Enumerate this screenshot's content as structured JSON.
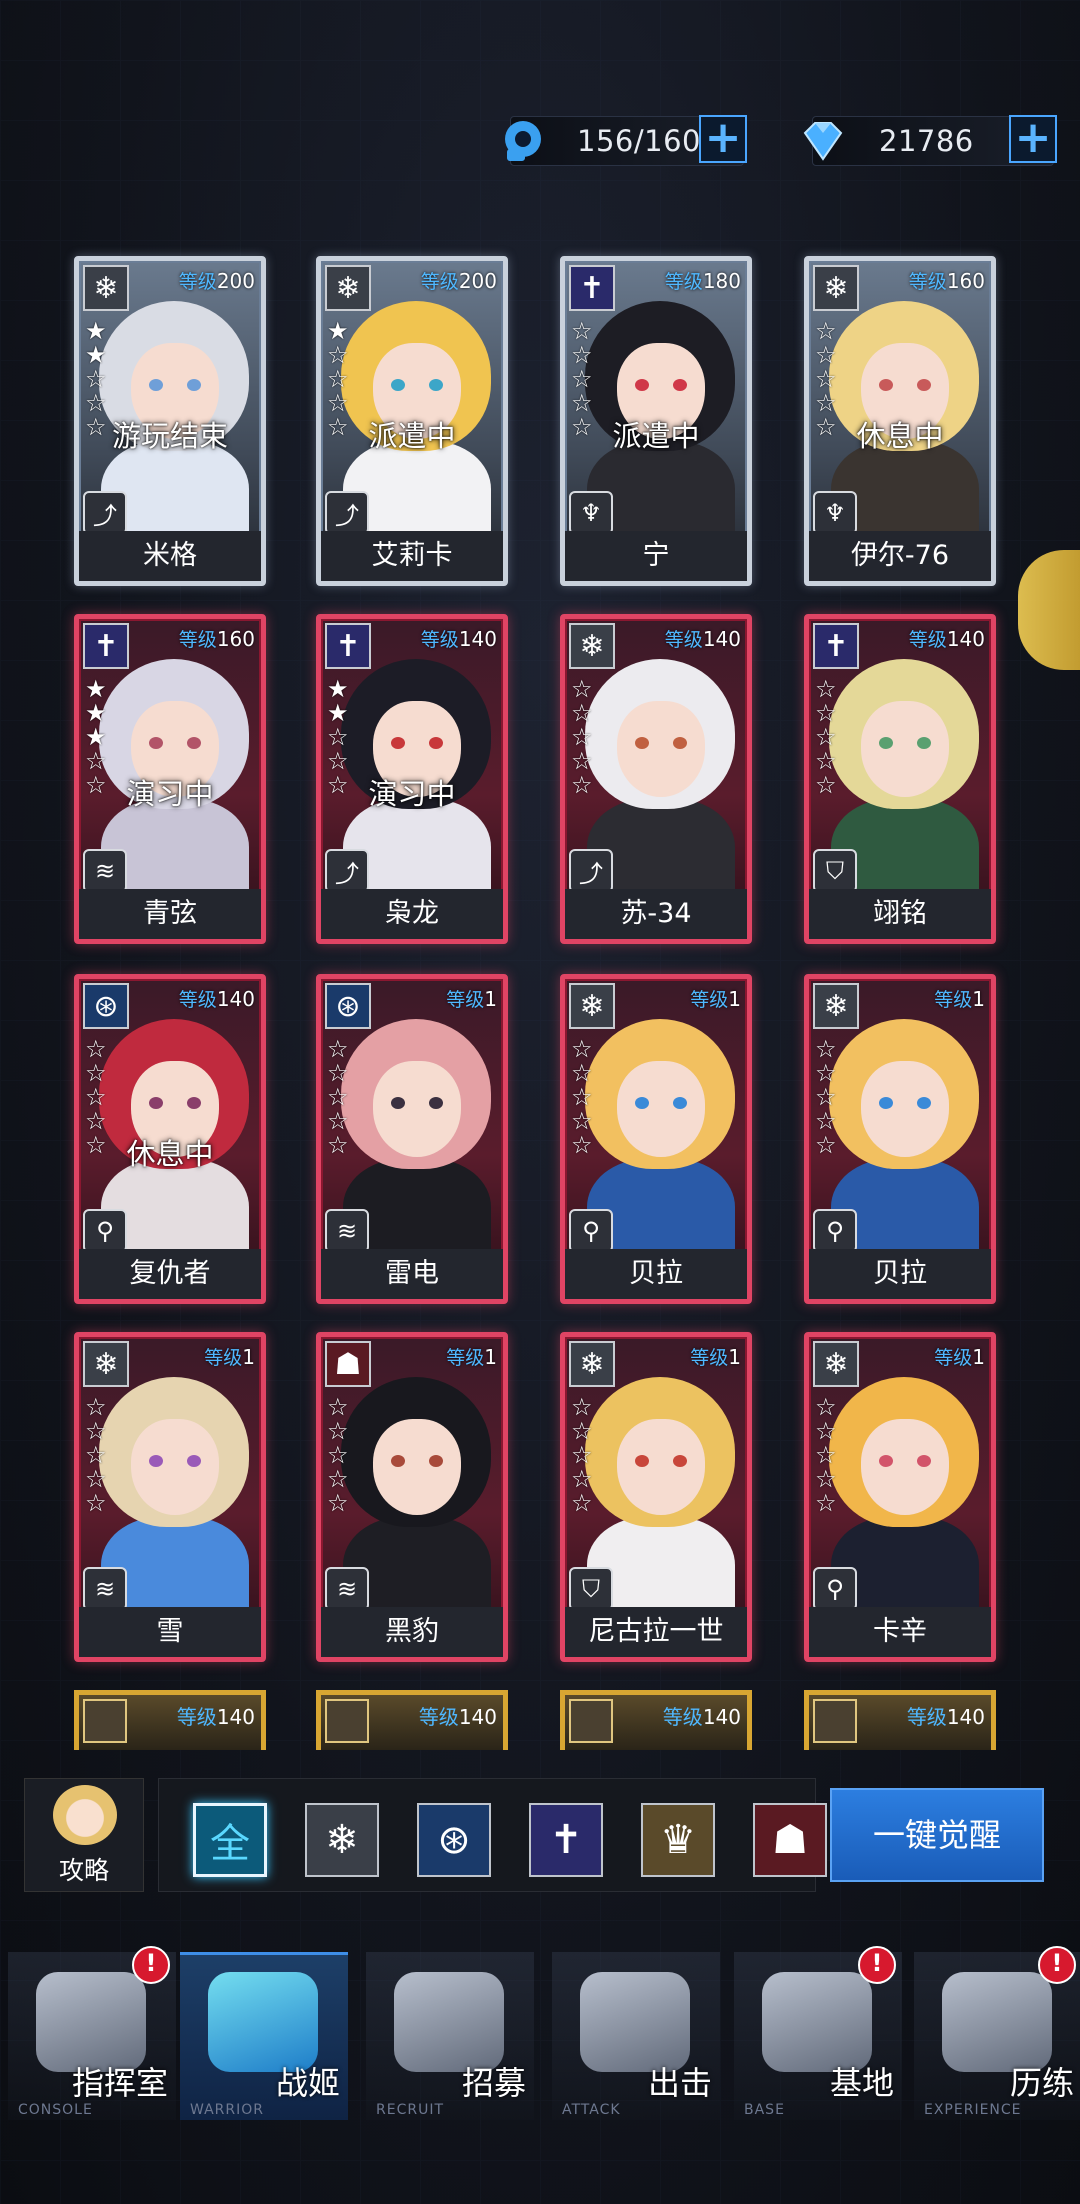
{
  "resources": {
    "stamina": {
      "icon": "stamina-head-icon",
      "value": "156/160",
      "plus": "+"
    },
    "diamond": {
      "icon": "diamond-icon",
      "value": "21786",
      "plus": "+"
    }
  },
  "labels": {
    "level_prefix": "等级"
  },
  "cards": [
    {
      "name": "米格",
      "level": "200",
      "status": "游玩结束",
      "frame": "silver",
      "element": "ice",
      "element_glyph": "❄",
      "class_glyph": "⤴",
      "stars": 2,
      "hair": "#d9dce4",
      "eyes": "#6f9fd8",
      "outfit": "#dfe6f2"
    },
    {
      "name": "艾莉卡",
      "level": "200",
      "status": "派遣中",
      "frame": "silver",
      "element": "ice",
      "element_glyph": "❄",
      "class_glyph": "⤴",
      "stars": 1,
      "hair": "#f0c450",
      "eyes": "#3ca6c8",
      "outfit": "#f2f2f4"
    },
    {
      "name": "宁",
      "level": "180",
      "status": "派遣中",
      "frame": "silver",
      "element": "lightning",
      "element_glyph": "✝",
      "class_glyph": "♆",
      "stars": 0,
      "hair": "#1d1d24",
      "eyes": "#d03848",
      "outfit": "#2a2a30"
    },
    {
      "name": "伊尔-76",
      "level": "160",
      "status": "休息中",
      "frame": "silver",
      "element": "ice",
      "element_glyph": "❄",
      "class_glyph": "♆",
      "stars": 0,
      "hair": "#eed386",
      "eyes": "#c85a5a",
      "outfit": "#3a3430"
    },
    {
      "name": "青弦",
      "level": "160",
      "status": "演习中",
      "frame": "red",
      "element": "lightning",
      "element_glyph": "✝",
      "class_glyph": "≋",
      "stars": 3,
      "hair": "#d8d6e4",
      "eyes": "#b25468",
      "outfit": "#c8c4d6"
    },
    {
      "name": "枭龙",
      "level": "140",
      "status": "演习中",
      "frame": "red",
      "element": "lightning",
      "element_glyph": "✝",
      "class_glyph": "⤴",
      "stars": 2,
      "hair": "#1c1c26",
      "eyes": "#c8383a",
      "outfit": "#e6e4ec"
    },
    {
      "name": "苏-34",
      "level": "140",
      "status": "",
      "frame": "red",
      "element": "ice",
      "element_glyph": "❄",
      "class_glyph": "⤴",
      "stars": 0,
      "hair": "#ecebef",
      "eyes": "#c06040",
      "outfit": "#2c2c32"
    },
    {
      "name": "翊铭",
      "level": "140",
      "status": "",
      "frame": "red",
      "element": "lightning",
      "element_glyph": "✝",
      "class_glyph": "⛉",
      "stars": 0,
      "hair": "#e4d898",
      "eyes": "#5aa070",
      "outfit": "#2f5a40"
    },
    {
      "name": "复仇者",
      "level": "140",
      "status": "休息中",
      "frame": "red",
      "element": "wind",
      "element_glyph": "⊛",
      "class_glyph": "⚲",
      "stars": 0,
      "hair": "#c02a3e",
      "eyes": "#8a3e6a",
      "outfit": "#e4dde0"
    },
    {
      "name": "雷电",
      "level": "1",
      "status": "",
      "frame": "red",
      "element": "wind",
      "element_glyph": "⊛",
      "class_glyph": "≋",
      "stars": 0,
      "hair": "#e4a0a4",
      "eyes": "#3b3040",
      "outfit": "#1c1c22"
    },
    {
      "name": "贝拉",
      "level": "1",
      "status": "",
      "frame": "red",
      "element": "ice",
      "element_glyph": "❄",
      "class_glyph": "⚲",
      "stars": 0,
      "hair": "#f2c060",
      "eyes": "#3a8ad8",
      "outfit": "#2a5aa8"
    },
    {
      "name": "贝拉",
      "level": "1",
      "status": "",
      "frame": "red",
      "element": "ice",
      "element_glyph": "❄",
      "class_glyph": "⚲",
      "stars": 0,
      "hair": "#f2c060",
      "eyes": "#3a8ad8",
      "outfit": "#2a5aa8"
    },
    {
      "name": "雪",
      "level": "1",
      "status": "",
      "frame": "red",
      "element": "ice",
      "element_glyph": "❄",
      "class_glyph": "≋",
      "stars": 0,
      "hair": "#e6d4b0",
      "eyes": "#9a5ab8",
      "outfit": "#4a8adc"
    },
    {
      "name": "黑豹",
      "level": "1",
      "status": "",
      "frame": "red",
      "element": "fire",
      "element_glyph": "☗",
      "class_glyph": "≋",
      "stars": 0,
      "hair": "#18181e",
      "eyes": "#a84a3a",
      "outfit": "#1e1e24"
    },
    {
      "name": "尼古拉一世",
      "level": "1",
      "status": "",
      "frame": "red",
      "element": "ice",
      "element_glyph": "❄",
      "class_glyph": "⛉",
      "stars": 0,
      "hair": "#ecc260",
      "eyes": "#c8463a",
      "outfit": "#f0eef0"
    },
    {
      "name": "卡辛",
      "level": "1",
      "status": "",
      "frame": "red",
      "element": "ice",
      "element_glyph": "❄",
      "class_glyph": "⚲",
      "stars": 0,
      "hair": "#f1b64a",
      "eyes": "#d2546a",
      "outfit": "#1c2030"
    }
  ],
  "partial_levels": [
    "140",
    "140",
    "140",
    "140"
  ],
  "filter": {
    "guide_label": "攻略",
    "tabs": [
      {
        "label": "全",
        "icon": "all-tab",
        "active": true
      },
      {
        "label": "❄",
        "icon": "ice-element-icon",
        "active": false
      },
      {
        "label": "⊛",
        "icon": "wind-element-icon",
        "active": false
      },
      {
        "label": "✝",
        "icon": "lightning-element-icon",
        "active": false
      },
      {
        "label": "♛",
        "icon": "lion-element-icon",
        "active": false
      },
      {
        "label": "☗",
        "icon": "fire-element-icon",
        "active": false
      }
    ],
    "awaken_label": "一键觉醒"
  },
  "nav": [
    {
      "cn": "指挥室",
      "en": "CONSOLE",
      "badge": "!",
      "active": false
    },
    {
      "cn": "战姬",
      "en": "WARRIOR",
      "badge": "",
      "active": true
    },
    {
      "cn": "招募",
      "en": "RECRUIT",
      "badge": "",
      "active": false
    },
    {
      "cn": "出击",
      "en": "ATTACK",
      "badge": "",
      "active": false
    },
    {
      "cn": "基地",
      "en": "BASE",
      "badge": "!",
      "active": false
    },
    {
      "cn": "历练",
      "en": "EXPERIENCE",
      "badge": "!",
      "active": false
    }
  ]
}
